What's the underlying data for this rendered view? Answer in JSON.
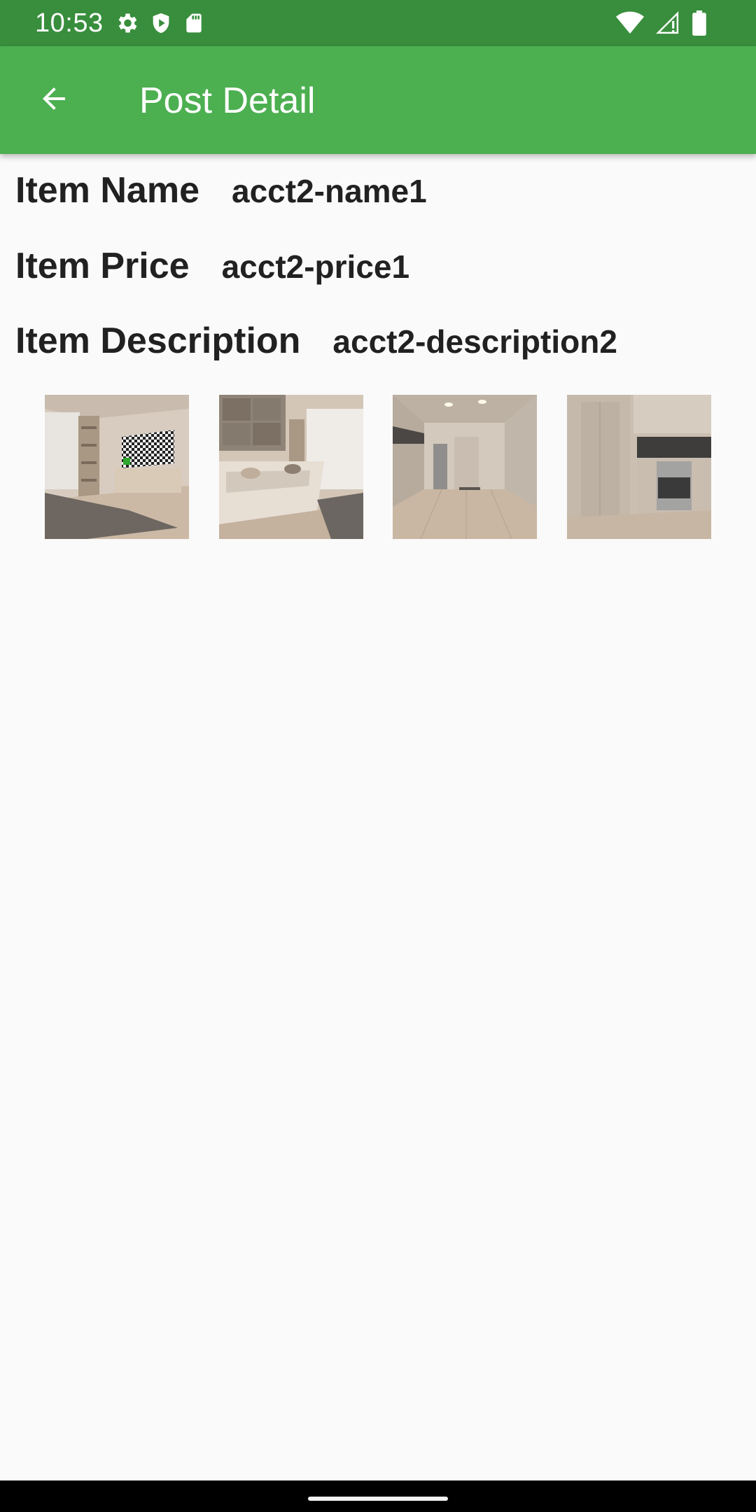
{
  "status_bar": {
    "time": "10:53",
    "left_icons": [
      "settings-icon",
      "shield-icon",
      "sd-card-icon"
    ],
    "right_icons": [
      "wifi-icon",
      "cell-signal-icon",
      "battery-icon"
    ]
  },
  "app_bar": {
    "title": "Post Detail",
    "back_icon": "arrow-back-icon",
    "background_color": "#4caf50",
    "status_color": "#388e3c"
  },
  "details": {
    "name": {
      "label": "Item Name",
      "value": "acct2-name1"
    },
    "price": {
      "label": "Item Price",
      "value": "acct2-price1"
    },
    "description": {
      "label": "Item Description",
      "value": "acct2-description2"
    }
  },
  "images": [
    {
      "name": "living-room-tv-thumbnail"
    },
    {
      "name": "living-room-sofa-thumbnail"
    },
    {
      "name": "kitchen-hallway-thumbnail"
    },
    {
      "name": "kitchen-stove-thumbnail"
    }
  ]
}
